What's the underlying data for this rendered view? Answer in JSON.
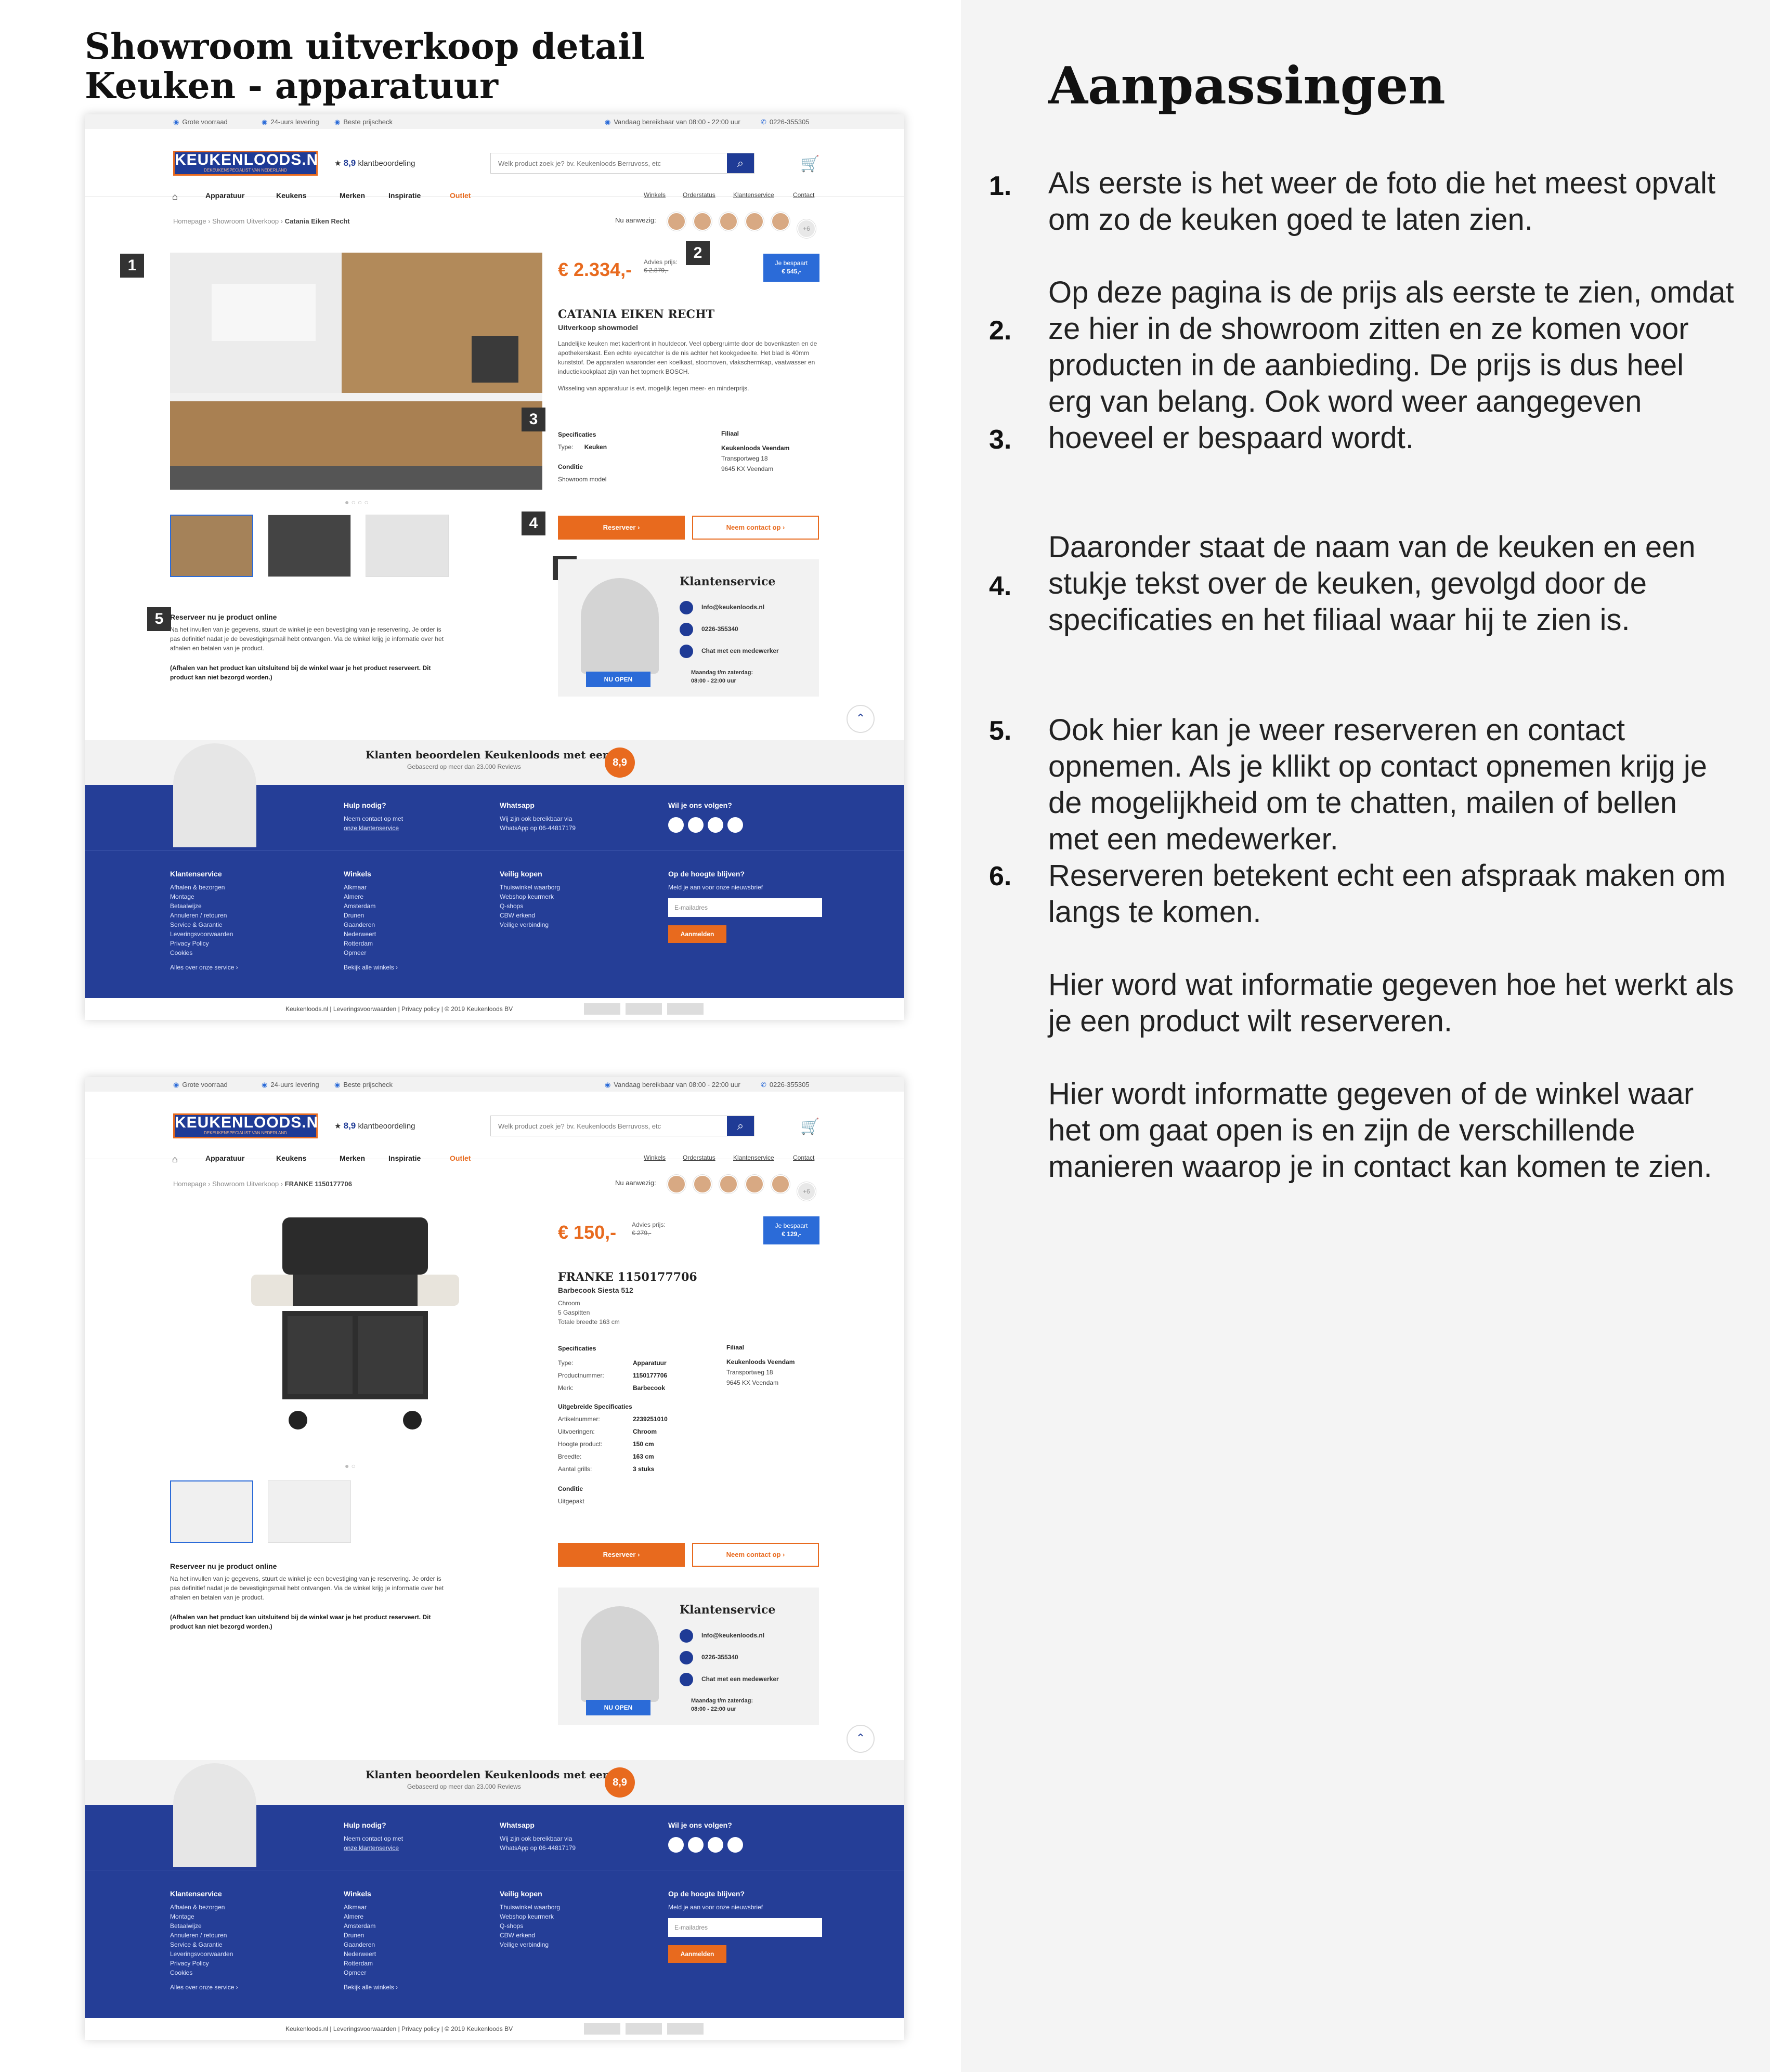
{
  "page_title_line1": "Showroom uitverkoop detail",
  "page_title_line2": "Keuken - apparatuur",
  "right_title": "Aanpassingen",
  "numbers": [
    "1.",
    "2.",
    "3.",
    "4.",
    "5.",
    "6."
  ],
  "paragraphs": [
    "Als eerste is het weer de foto die het meest opvalt om zo de keuken goed te laten zien.",
    "Op deze pagina is de prijs als eerste te zien, omdat ze hier in de showroom zitten en ze komen voor producten in de aanbieding. De prijs is dus heel erg van belang. Ook word weer aangegeven hoeveel er bespaard wordt.",
    "Daaronder staat de naam van de keuken en een stukje tekst over de keuken, gevolgd door de specificaties en het filiaal waar hij te zien is.",
    "Ook hier kan je weer reserveren en contact opnemen. Als je kllikt op contact opnemen krijg je de mogelijkheid om te chatten, mailen of bellen met een medewerker.",
    "Reserveren betekent echt een afspraak maken om langs te komen.",
    "Hier word wat informatie gegeven hoe het werkt als je een product wilt reserveren.",
    "Hier wordt informatte gegeven of de winkel waar het om gaat open is en zijn de verschillende manieren waarop je in contact kan komen te zien."
  ],
  "common": {
    "topbar": {
      "stock": "Grote voorraad",
      "delivery": "24-uurs levering",
      "price": "Beste prijscheck",
      "reach": "Vandaag bereikbaar van 08:00 - 22:00 uur",
      "phone": "0226-355305"
    },
    "logo": "KEUKENLOODS.NL",
    "logo_sub": "DEKEUKENSPECIALIST VAN NEDERLAND",
    "rating": "8,9",
    "rating_label": "klantbeoordeling",
    "search_placeholder": "Welk product zoek je? bv. Keukenloods Berruvoss, etc",
    "nav": {
      "apparatuur": "Apparatuur",
      "keukens": "Keukens",
      "merken": "Merken",
      "inspiratie": "Inspiratie",
      "outlet": "Outlet",
      "winkels": "Winkels",
      "orderstatus": "Orderstatus",
      "klantenservice": "Klantenservice",
      "contact": "Contact"
    },
    "crumb_home": "Homepage",
    "crumb_showroom": "Showroom Uitverkoop",
    "now_present": "Nu aanwezig:",
    "more": "+6",
    "advies_label": "Advies prijs:",
    "specificaties": "Specificaties",
    "filiaal": "Filiaal",
    "filiaal_name": "Keukenloods Veendam",
    "filiaal_street": "Transportweg 18",
    "filiaal_city": "9645 KX Veendam",
    "conditie": "Conditie",
    "reserveer_btn": "Reserveer",
    "contact_btn": "Neem contact op",
    "service_title": "Klantenservice",
    "service_mail": "Info@keukenloods.nl",
    "service_phone": "0226-355340",
    "service_chat": "Chat met een medewerker",
    "service_hours1": "Maandag t/m zaterdag:",
    "service_hours2": "08:00 - 22:00 uur",
    "nu_open": "NU OPEN",
    "res_title": "Reserveer nu je product online",
    "res_text": "Na het invullen van je gegevens, stuurt de winkel je een bevestiging van je reservering. Je order is pas definitief nadat je de bevestigingsmail hebt ontvangen. Via de winkel krijg je informatie over het afhalen en betalen van je product.",
    "res_bold": "(Afhalen van het product kan uitsluitend bij de winkel waar je het product reserveert. Dit product kan niet bezorgd worden.)",
    "review_title": "Klanten beoordelen Keukenloods met een",
    "review_sub": "Gebaseerd op meer dan 23.000 Reviews",
    "review_score": "8,9",
    "footer": {
      "help_h": "Hulp nodig?",
      "help_1": "Neem contact op met",
      "help_2": "onze klantenservice",
      "wa_h": "Whatsapp",
      "wa_1": "Wij zijn ook bereikbaar via",
      "wa_2": "WhatsApp op 06-44817179",
      "follow_h": "Wil je ons volgen?",
      "ks_h": "Klantenservice",
      "ks_items": "Afhalen & bezorgen\nMontage\nBetaalwijze\nAnnuleren / retouren\nService & Garantie\nLeveringsvoorwaarden\nPrivacy Policy\nCookies",
      "ks_more": "Alles over onze service ›",
      "w_h": "Winkels",
      "w_items": "Alkmaar\nAlmere\nAmsterdam\nDrunen\nGaanderen\nNederweert\nRotterdam\nOpmeer",
      "w_more": "Bekijk alle winkels ›",
      "vk_h": "Veilig kopen",
      "vk_items": "Thuiswinkel waarborg\nWebshop keurmerk\nQ-shops\nCBW erkend\nVeilige verbinding",
      "nb_h": "Op de hoogte blijven?",
      "nb_1": "Meld je aan voor onze nieuwsbrief",
      "nb_placeholder": "E-mailadres",
      "nb_btn": "Aanmelden"
    },
    "bottom": "Keukenloods.nl | Leveringsvoorwaarden | Privacy policy | © 2019 Keukenloods BV"
  },
  "s1": {
    "crumb_last": "Catania Eiken Recht",
    "price": "€ 2.334,-",
    "advies": "€ 2.879,-",
    "bespaard1": "Je bespaart",
    "bespaard2": "€ 545,-",
    "title": "CATANIA EIKEN RECHT",
    "sub": "Uitverkoop showmodel",
    "desc": "Landelijke keuken met kaderfront in houtdecor. Veel opbergruimte door de bovenkasten en de apothekerskast. Een echte eyecatcher is de nis achter het kookgedeelte. Het blad is 40mm kunststof. De apparaten waaronder een koelkast, stoomoven, vlakschermkap, vaatwasser en inductiekookplaat zijn van het topmerk BOSCH.",
    "desc2": "Wisseling van apparatuur is evt. mogelijk tegen meer- en minderprijs.",
    "type_label": "Type:",
    "type_val": "Keuken",
    "cond_val": "Showroom model",
    "badges": [
      "1",
      "2",
      "3",
      "4",
      "5",
      "6"
    ]
  },
  "s2": {
    "crumb_last": "FRANKE 1150177706",
    "price": "€ 150,-",
    "advies": "€ 279,-",
    "bespaard1": "Je bespaart",
    "bespaard2": "€ 129,-",
    "title": "FRANKE 1150177706",
    "sub": "Barbecook Siesta 512",
    "feat": "Chroom\n5 Gaspitten\nTotale breedte 163 cm",
    "spec_labels": "Type:\nProductnummer:\nMerk:",
    "spec_vals": "Apparatuur\n1150177706\nBarbecook",
    "ext_h": "Uitgebreide Specificaties",
    "ext_labels": "Artikelnummer:\nUitvoeringen:\nHoogte product:\nBreedte:\nAantal grills:",
    "ext_vals": "2239251010\nChroom\n150 cm\n163 cm\n3 stuks",
    "cond_val": "Uitgepakt"
  }
}
